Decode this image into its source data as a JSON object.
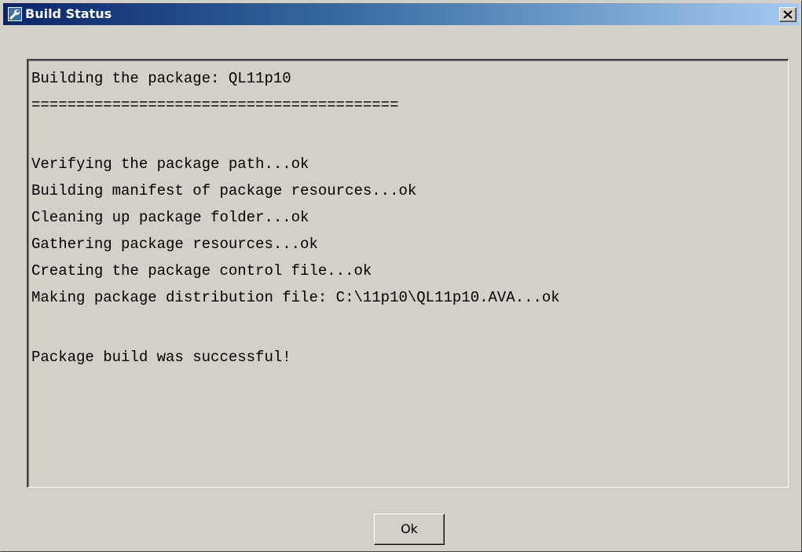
{
  "window": {
    "title": "Build Status",
    "icon": "build-wrench-icon",
    "close_icon": "close-icon"
  },
  "log": {
    "lines": [
      "Building the package: QL11p10",
      "=========================================",
      "",
      "Verifying the package path...ok",
      "Building manifest of package resources...ok",
      "Cleaning up package folder...ok",
      "Gathering package resources...ok",
      "Creating the package control file...ok",
      "Making package distribution file: C:\\11p10\\QL11p10.AVA...ok",
      "",
      "Package build was successful!"
    ]
  },
  "buttons": {
    "ok_label": "Ok"
  },
  "colors": {
    "title_gradient_start": "#0a246a",
    "title_gradient_end": "#a6caf0",
    "face": "#d4d0c8"
  }
}
